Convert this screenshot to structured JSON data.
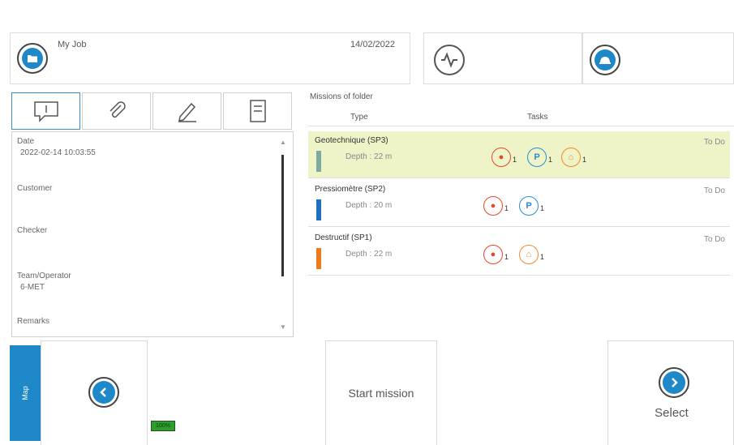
{
  "job": {
    "title": "My Job",
    "date": "14/02/2022",
    "icon": "folder-icon"
  },
  "header_icons": {
    "wave": "waveform-icon",
    "helmet": "helmet-icon"
  },
  "tool_tabs": [
    {
      "icon": "comment-icon"
    },
    {
      "icon": "paperclip-icon"
    },
    {
      "icon": "pen-icon"
    },
    {
      "icon": "report-icon"
    }
  ],
  "details": {
    "date_label": "Date",
    "date_value": "2022-02-14 10:03:55",
    "customer_label": "Customer",
    "checker_label": "Checker",
    "team_label": "Team/Operator",
    "team_value": "6-MET",
    "remarks_label": "Remarks"
  },
  "missions": {
    "title": "Missions of folder",
    "col_type": "Type",
    "col_tasks": "Tasks",
    "rows": [
      {
        "name": "Geotechnique (SP3)",
        "depth": "Depth : 22 m",
        "status": "To Do",
        "color": "#7fa8a0"
      },
      {
        "name": "Pressiomètre (SP2)",
        "depth": "Depth : 20 m",
        "status": "To Do",
        "color": "#1e6fc0"
      },
      {
        "name": "Destructif (SP1)",
        "depth": "Depth : 22 m",
        "status": "To Do",
        "color": "#f07a1a"
      }
    ]
  },
  "bottom": {
    "side_tab": "Map",
    "start_mission": "Start mission",
    "select": "Select",
    "battery": "100%"
  },
  "colors": {
    "accent": "#1e88c8",
    "selected_row": "#eef4c8"
  }
}
